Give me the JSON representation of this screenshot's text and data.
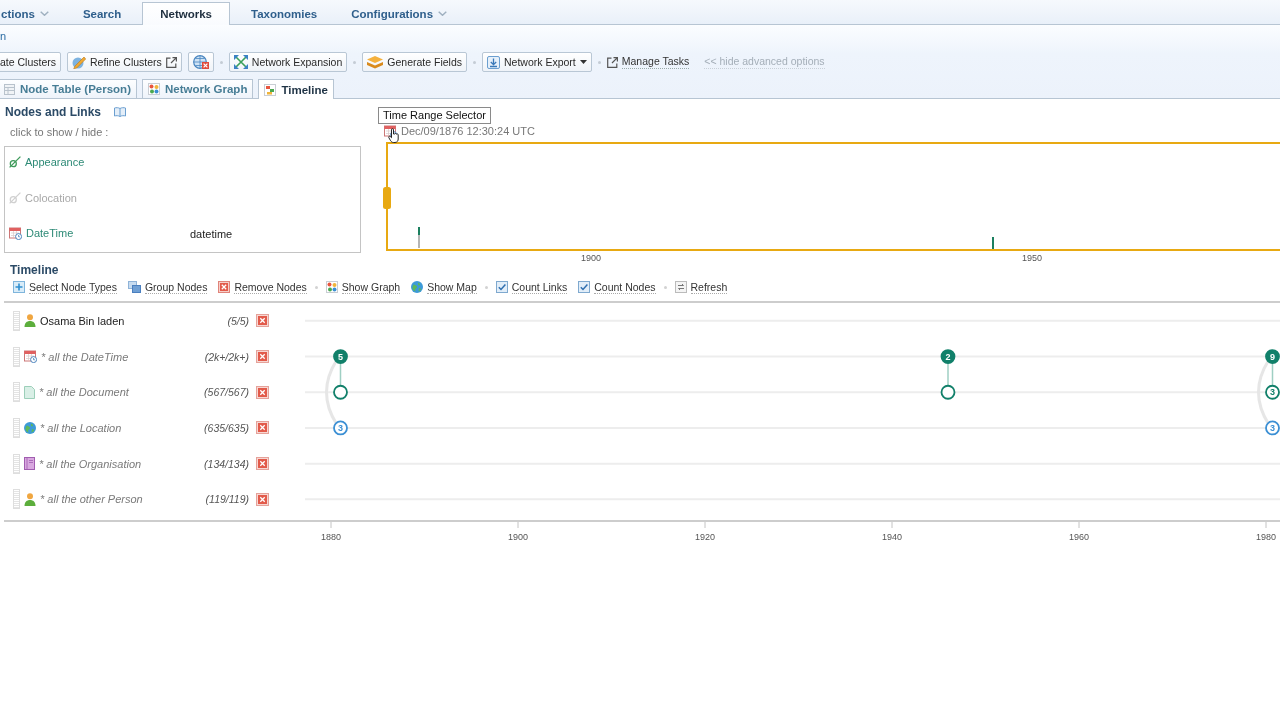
{
  "nav": {
    "tabs": [
      {
        "label": "ctions",
        "menu": true,
        "selected": false
      },
      {
        "label": "Search",
        "menu": false,
        "selected": false
      },
      {
        "label": "Networks",
        "menu": false,
        "selected": true
      },
      {
        "label": "Taxonomies",
        "menu": false,
        "selected": false
      },
      {
        "label": "Configurations",
        "menu": true,
        "selected": false
      }
    ]
  },
  "breadcrumb": "n",
  "toolbar": {
    "groups": [
      [
        {
          "kind": "button",
          "label": "ate Clusters"
        },
        {
          "kind": "button",
          "label": "Refine Clusters"
        },
        {
          "kind": "icon"
        }
      ],
      [
        {
          "kind": "button",
          "label": "Network Expansion"
        }
      ],
      [
        {
          "kind": "button",
          "label": "Generate Fields"
        }
      ],
      [
        {
          "kind": "menu",
          "label": "Network Export"
        }
      ],
      [
        {
          "kind": "link",
          "label": "Manage Tasks"
        },
        {
          "kind": "muted-link",
          "label": "<< hide advanced options"
        }
      ]
    ]
  },
  "view_tabs": [
    {
      "label": "Node Table (Person)",
      "selected": false
    },
    {
      "label": "Network Graph",
      "selected": false
    },
    {
      "label": "Timeline",
      "selected": true
    }
  ],
  "nodes_and_links": {
    "title": "Nodes and Links",
    "hint": "click to show / hide :",
    "items": [
      {
        "kind": "link",
        "label": "Appearance",
        "visible": true
      },
      {
        "kind": "link",
        "label": "Colocation",
        "visible": false
      },
      {
        "kind": "datetime",
        "label": "DateTime",
        "detail": "datetime",
        "visible": true
      }
    ]
  },
  "range_selector": {
    "tooltip": "Time Range Selector",
    "start": "Dec/09/1876 12:30:24 UTC",
    "axis_labels": [
      "1900",
      "1950"
    ]
  },
  "timeline": {
    "title": "Timeline",
    "toolbar": [
      [
        {
          "kind": "action",
          "label": "Select Node Types"
        },
        {
          "kind": "action",
          "label": "Group Nodes"
        },
        {
          "kind": "action",
          "label": "Remove Nodes"
        }
      ],
      [
        {
          "kind": "action",
          "label": "Show Graph"
        },
        {
          "kind": "action",
          "label": "Show Map"
        }
      ],
      [
        {
          "kind": "checkbox",
          "label": "Count Links",
          "checked": true
        },
        {
          "kind": "checkbox",
          "label": "Count Nodes",
          "checked": true
        }
      ],
      [
        {
          "kind": "action",
          "label": "Refresh"
        }
      ]
    ],
    "rows": [
      {
        "kind": "person",
        "group": false,
        "label": "Osama Bin laden",
        "count": "(5/5)"
      },
      {
        "kind": "datetime",
        "group": true,
        "label": "* all the DateTime",
        "count": "(2k+/2k+)"
      },
      {
        "kind": "document",
        "group": true,
        "label": "* all the Document",
        "count": "(567/567)"
      },
      {
        "kind": "location",
        "group": true,
        "label": "* all the Location",
        "count": "(635/635)"
      },
      {
        "kind": "organisation",
        "group": true,
        "label": "* all the Organisation",
        "count": "(134/134)"
      },
      {
        "kind": "person",
        "group": true,
        "label": "* all the other Person",
        "count": "(119/119)"
      }
    ],
    "plot": {
      "axis_labels": [
        "1880",
        "1900",
        "1920",
        "1940",
        "1960",
        "1980"
      ],
      "markers": [
        {
          "kind": "filled",
          "color": "#11806a",
          "label": "5"
        },
        {
          "kind": "filled",
          "color": "#11806a",
          "label": "2"
        },
        {
          "kind": "filled",
          "color": "#11806a",
          "label": "9"
        },
        {
          "kind": "hollow",
          "color": "#11806a"
        },
        {
          "kind": "hollow",
          "color": "#11806a"
        },
        {
          "kind": "hollow",
          "color": "#11806a",
          "label": "3"
        },
        {
          "kind": "hollow",
          "color": "#3b8fd4",
          "label": "3"
        },
        {
          "kind": "hollow",
          "color": "#3b8fd4",
          "label": "3"
        }
      ]
    }
  }
}
